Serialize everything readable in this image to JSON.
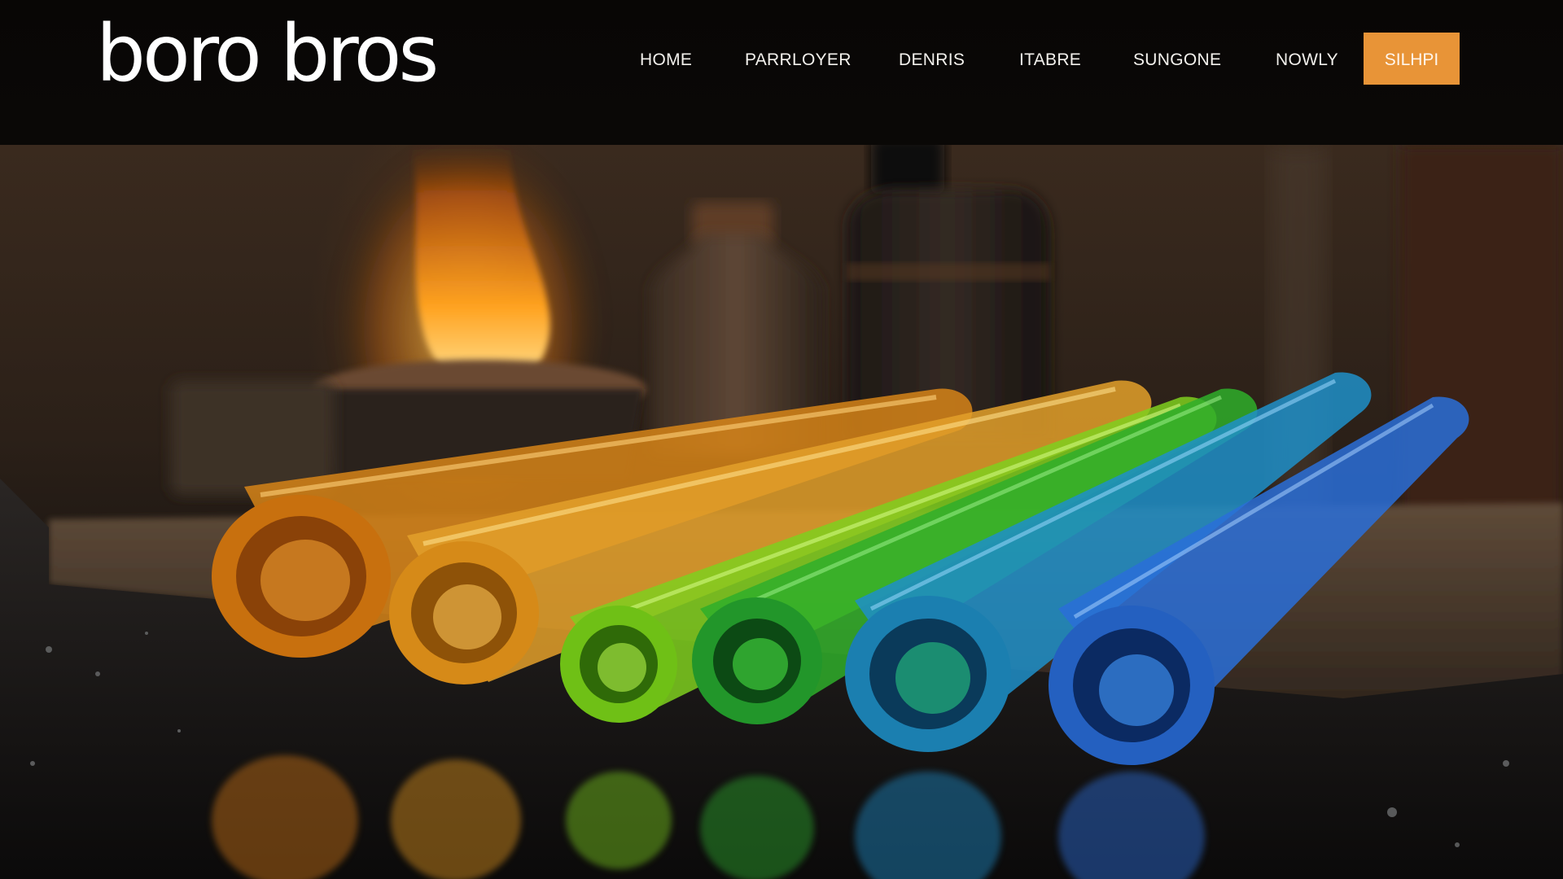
{
  "brand": {
    "logo_text": "boro bros"
  },
  "nav": {
    "items": [
      {
        "label": "HOME"
      },
      {
        "label": "PARRLOYER"
      },
      {
        "label": "DENRIS"
      },
      {
        "label": "ITABRE"
      },
      {
        "label": "SUNGONE"
      },
      {
        "label": "NOWLY"
      }
    ],
    "cta_label": "SILHPI"
  },
  "colors": {
    "header_bg": "#0a0806",
    "accent": "#e89437",
    "nav_text": "#f2f0ec"
  },
  "hero": {
    "scene": "borosilicate-glass-tubes-with-torch-flame",
    "tube_colors": [
      "#e08a1c",
      "#e3a02a",
      "#7fcf1e",
      "#2fae2a",
      "#1f8fc9",
      "#2a6fd8"
    ]
  }
}
